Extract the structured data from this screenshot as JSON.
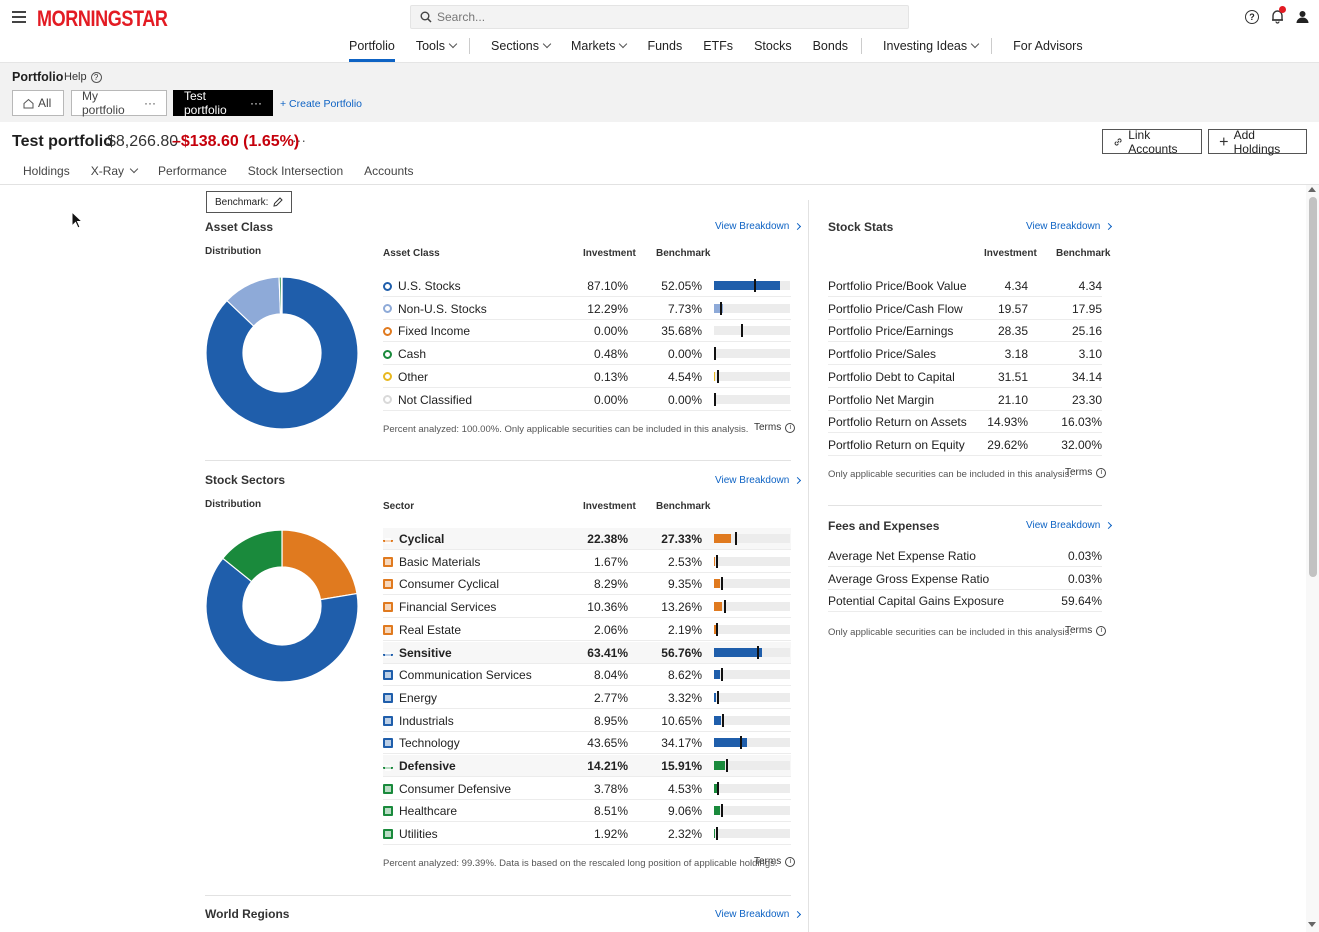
{
  "header": {
    "logo": "MORNINGSTAR",
    "search_placeholder": "Search...",
    "nav": [
      "Portfolio",
      "Tools",
      "Sections",
      "Markets",
      "Funds",
      "ETFs",
      "Stocks",
      "Bonds",
      "Investing Ideas",
      "For Advisors"
    ]
  },
  "band": {
    "title": "Portfolio",
    "help": "Help",
    "tab_all": "All",
    "tab_my": "My portfolio",
    "tab_test": "Test portfolio",
    "more": "···",
    "create": "+ Create Portfolio"
  },
  "portfolio": {
    "name": "Test portfolio",
    "value": "$8,266.80",
    "change": "–$138.60 (1.65%)",
    "more": "···",
    "link_accounts": "Link Accounts",
    "add_holdings": "Add Holdings"
  },
  "subtabs": [
    "Holdings",
    "X-Ray",
    "Performance",
    "Stock Intersection",
    "Accounts"
  ],
  "benchmark_button": "Benchmark:",
  "asset_class": {
    "title": "Asset Class",
    "view": "View Breakdown",
    "distribution": "Distribution",
    "col_name": "Asset Class",
    "col_inv": "Investment",
    "col_bench": "Benchmark",
    "rows": [
      {
        "name": "U.S. Stocks",
        "inv": "87.10%",
        "bench": "52.05%",
        "inv_v": 87.1,
        "bench_v": 52.05,
        "color": "#1f5eab"
      },
      {
        "name": "Non-U.S. Stocks",
        "inv": "12.29%",
        "bench": "7.73%",
        "inv_v": 12.29,
        "bench_v": 7.73,
        "color": "#8eaad8"
      },
      {
        "name": "Fixed Income",
        "inv": "0.00%",
        "bench": "35.68%",
        "inv_v": 0,
        "bench_v": 35.68,
        "color": "#e07a1f"
      },
      {
        "name": "Cash",
        "inv": "0.48%",
        "bench": "0.00%",
        "inv_v": 0.48,
        "bench_v": 0,
        "color": "#1a8a3c"
      },
      {
        "name": "Other",
        "inv": "0.13%",
        "bench": "4.54%",
        "inv_v": 0.13,
        "bench_v": 4.54,
        "color": "#e8b820"
      },
      {
        "name": "Not Classified",
        "inv": "0.00%",
        "bench": "0.00%",
        "inv_v": 0,
        "bench_v": 0,
        "color": "#d9d9d9"
      }
    ],
    "note": "Percent analyzed: 100.00%. Only applicable securities can be included in this analysis.",
    "terms": "Terms"
  },
  "stock_sectors": {
    "title": "Stock Sectors",
    "view": "View Breakdown",
    "distribution": "Distribution",
    "col_name": "Sector",
    "col_inv": "Investment",
    "col_bench": "Benchmark",
    "rows": [
      {
        "name": "Cyclical",
        "inv": "22.38%",
        "bench": "27.33%",
        "inv_v": 22.38,
        "bench_v": 27.33,
        "color": "#e07a1f",
        "bold": true
      },
      {
        "name": "Basic Materials",
        "inv": "1.67%",
        "bench": "2.53%",
        "inv_v": 1.67,
        "bench_v": 2.53,
        "color": "#e07a1f",
        "bold": false
      },
      {
        "name": "Consumer Cyclical",
        "inv": "8.29%",
        "bench": "9.35%",
        "inv_v": 8.29,
        "bench_v": 9.35,
        "color": "#e07a1f",
        "bold": false
      },
      {
        "name": "Financial Services",
        "inv": "10.36%",
        "bench": "13.26%",
        "inv_v": 10.36,
        "bench_v": 13.26,
        "color": "#e07a1f",
        "bold": false
      },
      {
        "name": "Real Estate",
        "inv": "2.06%",
        "bench": "2.19%",
        "inv_v": 2.06,
        "bench_v": 2.19,
        "color": "#e07a1f",
        "bold": false
      },
      {
        "name": "Sensitive",
        "inv": "63.41%",
        "bench": "56.76%",
        "inv_v": 63.41,
        "bench_v": 56.76,
        "color": "#1f5eab",
        "bold": true
      },
      {
        "name": "Communication Services",
        "inv": "8.04%",
        "bench": "8.62%",
        "inv_v": 8.04,
        "bench_v": 8.62,
        "color": "#1f5eab",
        "bold": false
      },
      {
        "name": "Energy",
        "inv": "2.77%",
        "bench": "3.32%",
        "inv_v": 2.77,
        "bench_v": 3.32,
        "color": "#1f5eab",
        "bold": false
      },
      {
        "name": "Industrials",
        "inv": "8.95%",
        "bench": "10.65%",
        "inv_v": 8.95,
        "bench_v": 10.65,
        "color": "#1f5eab",
        "bold": false
      },
      {
        "name": "Technology",
        "inv": "43.65%",
        "bench": "34.17%",
        "inv_v": 43.65,
        "bench_v": 34.17,
        "color": "#1f5eab",
        "bold": false
      },
      {
        "name": "Defensive",
        "inv": "14.21%",
        "bench": "15.91%",
        "inv_v": 14.21,
        "bench_v": 15.91,
        "color": "#1a8a3c",
        "bold": true
      },
      {
        "name": "Consumer Defensive",
        "inv": "3.78%",
        "bench": "4.53%",
        "inv_v": 3.78,
        "bench_v": 4.53,
        "color": "#1a8a3c",
        "bold": false
      },
      {
        "name": "Healthcare",
        "inv": "8.51%",
        "bench": "9.06%",
        "inv_v": 8.51,
        "bench_v": 9.06,
        "color": "#1a8a3c",
        "bold": false
      },
      {
        "name": "Utilities",
        "inv": "1.92%",
        "bench": "2.32%",
        "inv_v": 1.92,
        "bench_v": 2.32,
        "color": "#1a8a3c",
        "bold": false
      }
    ],
    "note": "Percent analyzed: 99.39%. Data is based on the rescaled long position of applicable holdings.",
    "terms": "Terms"
  },
  "world_regions": {
    "title": "World Regions",
    "view": "View Breakdown"
  },
  "stock_stats": {
    "title": "Stock Stats",
    "view": "View Breakdown",
    "col_inv": "Investment",
    "col_bench": "Benchmark",
    "rows": [
      {
        "name": "Portfolio Price/Book Value",
        "inv": "4.34",
        "bench": "4.34"
      },
      {
        "name": "Portfolio Price/Cash Flow",
        "inv": "19.57",
        "bench": "17.95"
      },
      {
        "name": "Portfolio Price/Earnings",
        "inv": "28.35",
        "bench": "25.16"
      },
      {
        "name": "Portfolio Price/Sales",
        "inv": "3.18",
        "bench": "3.10"
      },
      {
        "name": "Portfolio Debt to Capital",
        "inv": "31.51",
        "bench": "34.14"
      },
      {
        "name": "Portfolio Net Margin",
        "inv": "21.10",
        "bench": "23.30"
      },
      {
        "name": "Portfolio Return on Assets",
        "inv": "14.93%",
        "bench": "16.03%"
      },
      {
        "name": "Portfolio Return on Equity",
        "inv": "29.62%",
        "bench": "32.00%"
      }
    ],
    "note": "Only applicable securities can be included in this analysis.",
    "terms": "Terms"
  },
  "fees": {
    "title": "Fees and Expenses",
    "view": "View Breakdown",
    "rows": [
      {
        "name": "Average Net Expense Ratio",
        "val": "0.03%"
      },
      {
        "name": "Average Gross Expense Ratio",
        "val": "0.03%"
      },
      {
        "name": "Potential Capital Gains Exposure",
        "val": "59.64%"
      }
    ],
    "note": "Only applicable securities can be included in this analysis.",
    "terms": "Terms"
  },
  "donut_asset": [
    {
      "name": "U.S. Stocks",
      "value": 87.1,
      "color": "#1f5eab"
    },
    {
      "name": "Non-U.S. Stocks",
      "value": 12.29,
      "color": "#8eaad8"
    },
    {
      "name": "Cash",
      "value": 0.48,
      "color": "#1a8a3c"
    },
    {
      "name": "Other",
      "value": 0.13,
      "color": "#e8b820"
    }
  ],
  "donut_sector": [
    {
      "name": "Cyclical",
      "value": 22.38,
      "color": "#e07a1f"
    },
    {
      "name": "Sensitive",
      "value": 63.41,
      "color": "#1f5eab"
    },
    {
      "name": "Defensive",
      "value": 14.21,
      "color": "#1a8a3c"
    }
  ]
}
